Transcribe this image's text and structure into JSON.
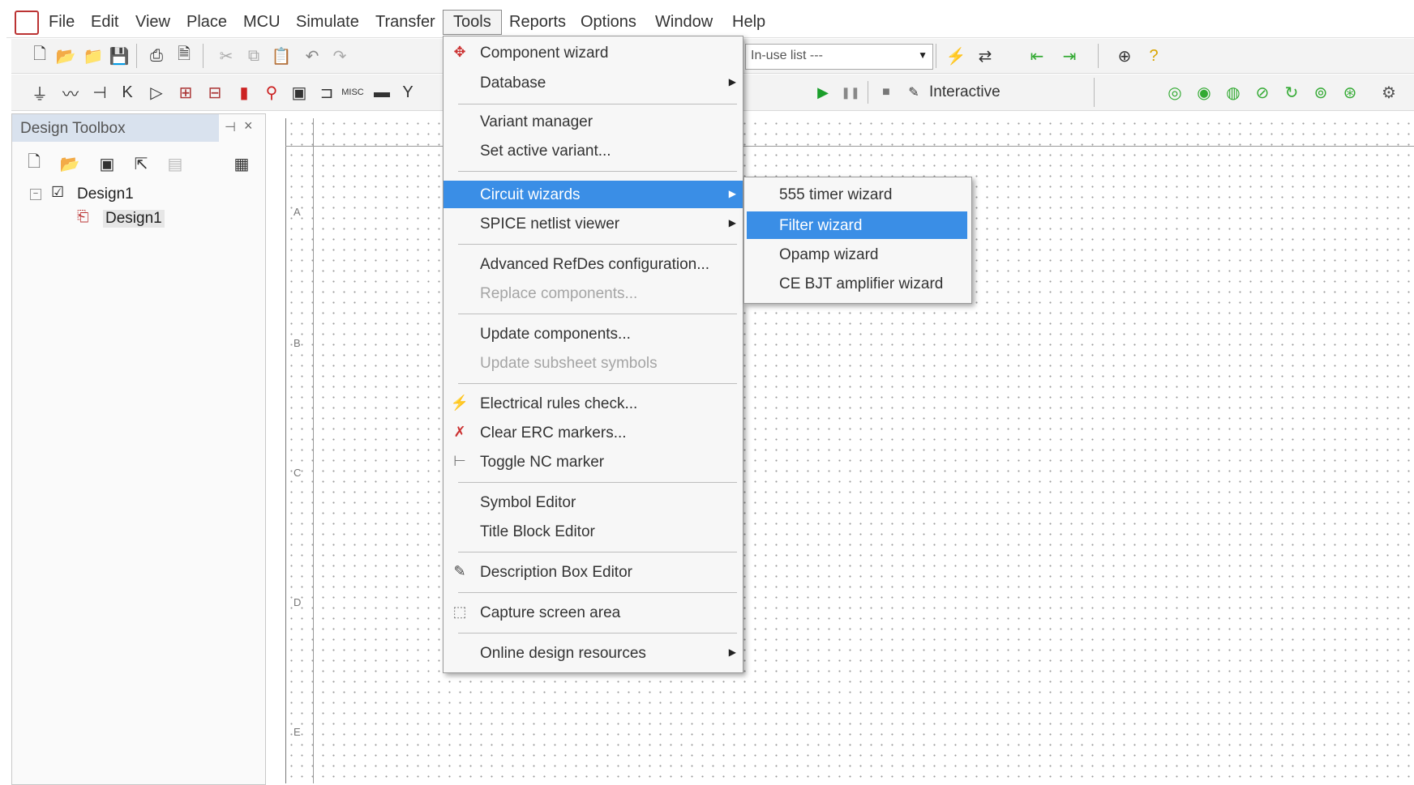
{
  "menubar": {
    "items": [
      "File",
      "Edit",
      "View",
      "Place",
      "MCU",
      "Simulate",
      "Transfer",
      "Tools",
      "Reports",
      "Options",
      "Window",
      "Help"
    ],
    "active": "Tools"
  },
  "toolbar": {
    "list_dropdown_value": "In-use list ---",
    "interactive_label": "Interactive"
  },
  "toolbox": {
    "title": "Design Toolbox",
    "tree": [
      "Design1",
      "Design1"
    ]
  },
  "canvas": {
    "row_labels": [
      "A",
      "B",
      "C",
      "D",
      "E"
    ]
  },
  "tools_menu": {
    "items": [
      {
        "label": "Component wizard",
        "icon": "component-wizard-icon"
      },
      {
        "label": "Database",
        "submenu": true
      },
      {
        "label": "Variant manager"
      },
      {
        "label": "Set active variant..."
      },
      {
        "label": "Circuit wizards",
        "submenu": true,
        "highlighted": true
      },
      {
        "label": "SPICE netlist viewer",
        "submenu": true
      },
      {
        "label": "Advanced RefDes configuration..."
      },
      {
        "label": "Replace components...",
        "disabled": true
      },
      {
        "label": "Update components..."
      },
      {
        "label": "Update subsheet symbols",
        "disabled": true
      },
      {
        "label": "Electrical rules check...",
        "icon": "erc-icon"
      },
      {
        "label": "Clear ERC markers...",
        "icon": "clear-erc-icon"
      },
      {
        "label": "Toggle NC marker",
        "icon": "nc-marker-icon"
      },
      {
        "label": "Symbol Editor"
      },
      {
        "label": "Title Block Editor"
      },
      {
        "label": "Description Box Editor",
        "icon": "description-box-icon"
      },
      {
        "label": "Capture screen area",
        "icon": "capture-area-icon"
      },
      {
        "label": "Online design resources",
        "submenu": true
      }
    ]
  },
  "circuit_wizards_submenu": {
    "items": [
      {
        "label": "555 timer wizard"
      },
      {
        "label": "Filter wizard",
        "highlighted": true
      },
      {
        "label": "Opamp wizard"
      },
      {
        "label": "CE BJT amplifier wizard"
      }
    ]
  }
}
